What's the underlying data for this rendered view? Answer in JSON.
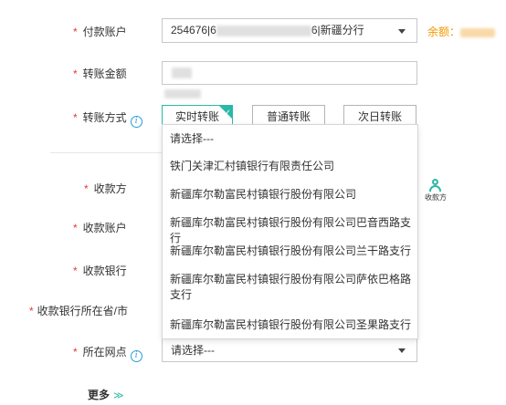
{
  "form": {
    "payer_account": {
      "label": "付款账户",
      "value_prefix": "254676|6",
      "value_suffix": "6|新疆分行",
      "balance_label": "余额："
    },
    "amount": {
      "label": "转账金额"
    },
    "method": {
      "label": "转账方式",
      "info_icon": "i",
      "options": [
        {
          "label": "实时转账",
          "selected": true
        },
        {
          "label": "普通转账",
          "selected": false
        },
        {
          "label": "次日转账",
          "selected": false
        }
      ],
      "check_mark": "✓"
    },
    "payee": {
      "label": "收款方",
      "icon_label": "收款方"
    },
    "payee_account": {
      "label": "收款账户"
    },
    "payee_bank": {
      "label": "收款银行"
    },
    "payee_bank_region": {
      "label": "收款银行所在省/市"
    },
    "branch": {
      "label": "所在网点",
      "info_icon": "i",
      "value": "请选择---"
    },
    "more": {
      "label": "更多",
      "chevron": "≫"
    },
    "required_mark": "*"
  },
  "dropdown": {
    "options": [
      "请选择---",
      "铁门关津汇村镇银行有限责任公司",
      "新疆库尔勒富民村镇银行股份有限公司",
      "新疆库尔勒富民村镇银行股份有限公司巴音西路支行",
      "新疆库尔勒富民村镇银行股份有限公司兰干路支行",
      "新疆库尔勒富民村镇银行股份有限公司萨依巴格路支行",
      "新疆库尔勒富民村镇银行股份有限公司圣果路支行"
    ]
  },
  "colors": {
    "accent": "#2bb8a6",
    "required": "#e53935",
    "balance": "#f39800",
    "info": "#2a9bd8"
  }
}
